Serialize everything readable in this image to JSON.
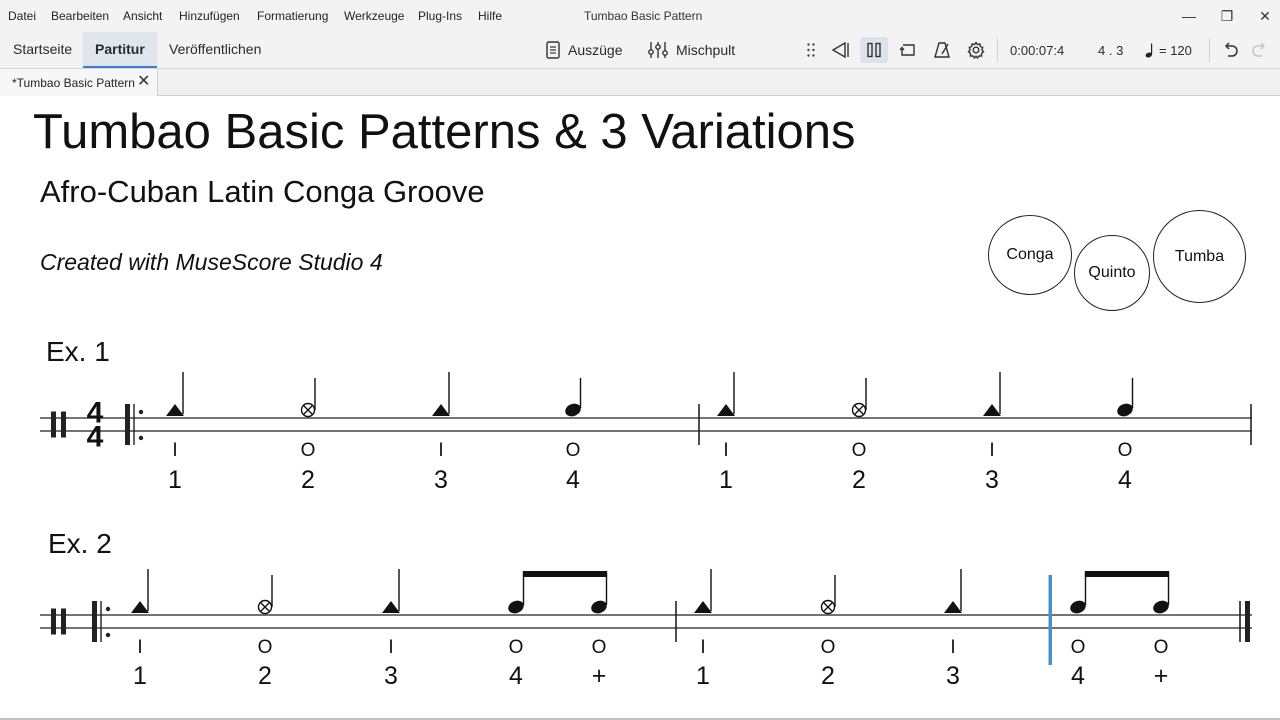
{
  "menu": [
    "Datei",
    "Bearbeiten",
    "Ansicht",
    "Hinzufügen",
    "Formatierung",
    "Werkzeuge",
    "Plug-Ins",
    "Hilfe"
  ],
  "window_title": "Tumbao Basic Pattern",
  "window_controls": {
    "minimize": "—",
    "maximize": "❐",
    "close": "✕"
  },
  "nav_tabs": [
    {
      "label": "Startseite",
      "active": false
    },
    {
      "label": "Partitur",
      "active": true
    },
    {
      "label": "Veröffentlichen",
      "active": false
    }
  ],
  "toolbar": {
    "parts_label": "Auszüge",
    "mixer_label": "Mischpult",
    "time": "0:00:07:4",
    "position": "4 . 3",
    "tempo_value": "= 120",
    "active_icon": "pause-icon",
    "icons": [
      "drag-handle-icon",
      "rewind-icon",
      "pause-icon",
      "loop-icon",
      "metronome-icon",
      "gear-icon",
      "undo-icon",
      "redo-icon"
    ]
  },
  "document_tab": {
    "label": "*Tumbao Basic Pattern",
    "close": "✕"
  },
  "score": {
    "title": "Tumbao Basic Patterns & 3 Variations",
    "subtitle": "Afro-Cuban Latin Conga Groove",
    "composer": "Created with MuseScore Studio 4",
    "drums": [
      "Conga",
      "Quinto",
      "Tumba"
    ],
    "time_signature": "4/4",
    "examples": [
      {
        "label": "Ex. 1",
        "measures": [
          {
            "notes": [
              {
                "head": "slap",
                "stroke": "I",
                "count": "1"
              },
              {
                "head": "muted",
                "stroke": "O",
                "count": "2"
              },
              {
                "head": "slap",
                "stroke": "I",
                "count": "3"
              },
              {
                "head": "open",
                "stroke": "O",
                "count": "4"
              }
            ]
          },
          {
            "notes": [
              {
                "head": "slap",
                "stroke": "I",
                "count": "1"
              },
              {
                "head": "muted",
                "stroke": "O",
                "count": "2"
              },
              {
                "head": "slap",
                "stroke": "I",
                "count": "3"
              },
              {
                "head": "open",
                "stroke": "O",
                "count": "4"
              }
            ]
          }
        ]
      },
      {
        "label": "Ex. 2",
        "measures": [
          {
            "notes": [
              {
                "head": "slap",
                "stroke": "I",
                "count": "1"
              },
              {
                "head": "muted",
                "stroke": "O",
                "count": "2"
              },
              {
                "head": "slap",
                "stroke": "I",
                "count": "3"
              },
              {
                "head": "open",
                "stroke": "O",
                "count": "4",
                "beam": "start"
              },
              {
                "head": "open",
                "stroke": "O",
                "count": "+",
                "beam": "end"
              }
            ]
          },
          {
            "notes": [
              {
                "head": "slap",
                "stroke": "I",
                "count": "1"
              },
              {
                "head": "muted",
                "stroke": "O",
                "count": "2"
              },
              {
                "head": "slap",
                "stroke": "I",
                "count": "3"
              },
              {
                "head": "open",
                "stroke": "O",
                "count": "4",
                "beam": "start"
              },
              {
                "head": "open",
                "stroke": "O",
                "count": "+",
                "beam": "end"
              }
            ]
          }
        ]
      }
    ],
    "playback_cursor_color": "#4a90c8"
  }
}
